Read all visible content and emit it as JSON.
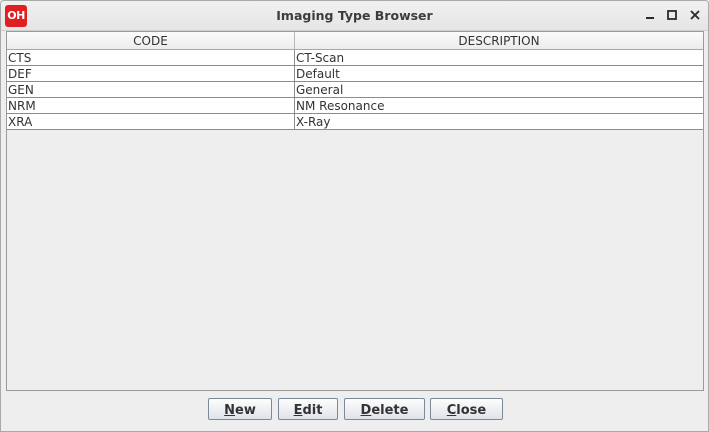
{
  "window": {
    "title": "Imaging Type Browser",
    "logo_text": "OH",
    "logo_color": "#e02020",
    "controls": [
      "minimize-icon",
      "maximize-icon",
      "close-icon"
    ]
  },
  "table": {
    "columns": [
      "CODE",
      "DESCRIPTION"
    ],
    "rows": [
      {
        "code": "CTS",
        "description": "CT-Scan"
      },
      {
        "code": "DEF",
        "description": "Default"
      },
      {
        "code": "GEN",
        "description": "General"
      },
      {
        "code": "NRM",
        "description": "NM Resonance"
      },
      {
        "code": "XRA",
        "description": "X-Ray"
      }
    ]
  },
  "buttons": {
    "new": {
      "mnemonic": "N",
      "rest": "ew"
    },
    "edit": {
      "mnemonic": "E",
      "rest": "dit"
    },
    "delete": {
      "mnemonic": "D",
      "rest": "elete"
    },
    "close": {
      "mnemonic": "C",
      "rest": "lose"
    }
  }
}
